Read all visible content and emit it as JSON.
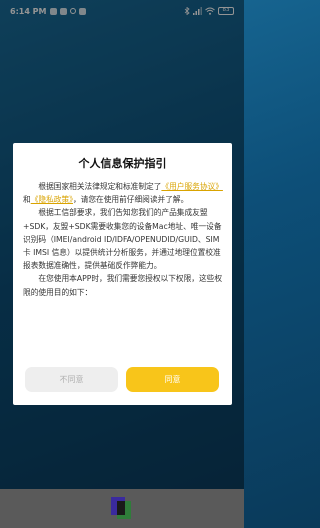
{
  "status_bar": {
    "time": "6:14 PM",
    "battery": "83"
  },
  "dialog": {
    "title": "个人信息保护指引",
    "p1": {
      "before": "根据国家相关法律规定和标准制定了",
      "link1": "《用户服务协议》",
      "mid": "和",
      "link2": "《隐私政策》",
      "after": "，请您在使用前仔细阅读并了解。"
    },
    "p2": "根据工信部要求，我们告知您我们的产品集成友盟+SDK，友盟+SDK需要收集您的设备Mac地址、唯一设备识别码（IMEI/android ID/IDFA/OPENUDID/GUID、SIM 卡 IMSI 信息）以提供统计分析服务，并通过地理位置校准报表数据准确性，提供基础反作弊能力。",
    "p3": "在您使用本APP时，我们需要您授权以下权限，这些权限的使用目的如下：",
    "disagree_label": "不同意",
    "agree_label": "同意"
  },
  "colors": {
    "accent": "#f8c51a",
    "link": "#d9a300",
    "background": "#0d4f78"
  }
}
